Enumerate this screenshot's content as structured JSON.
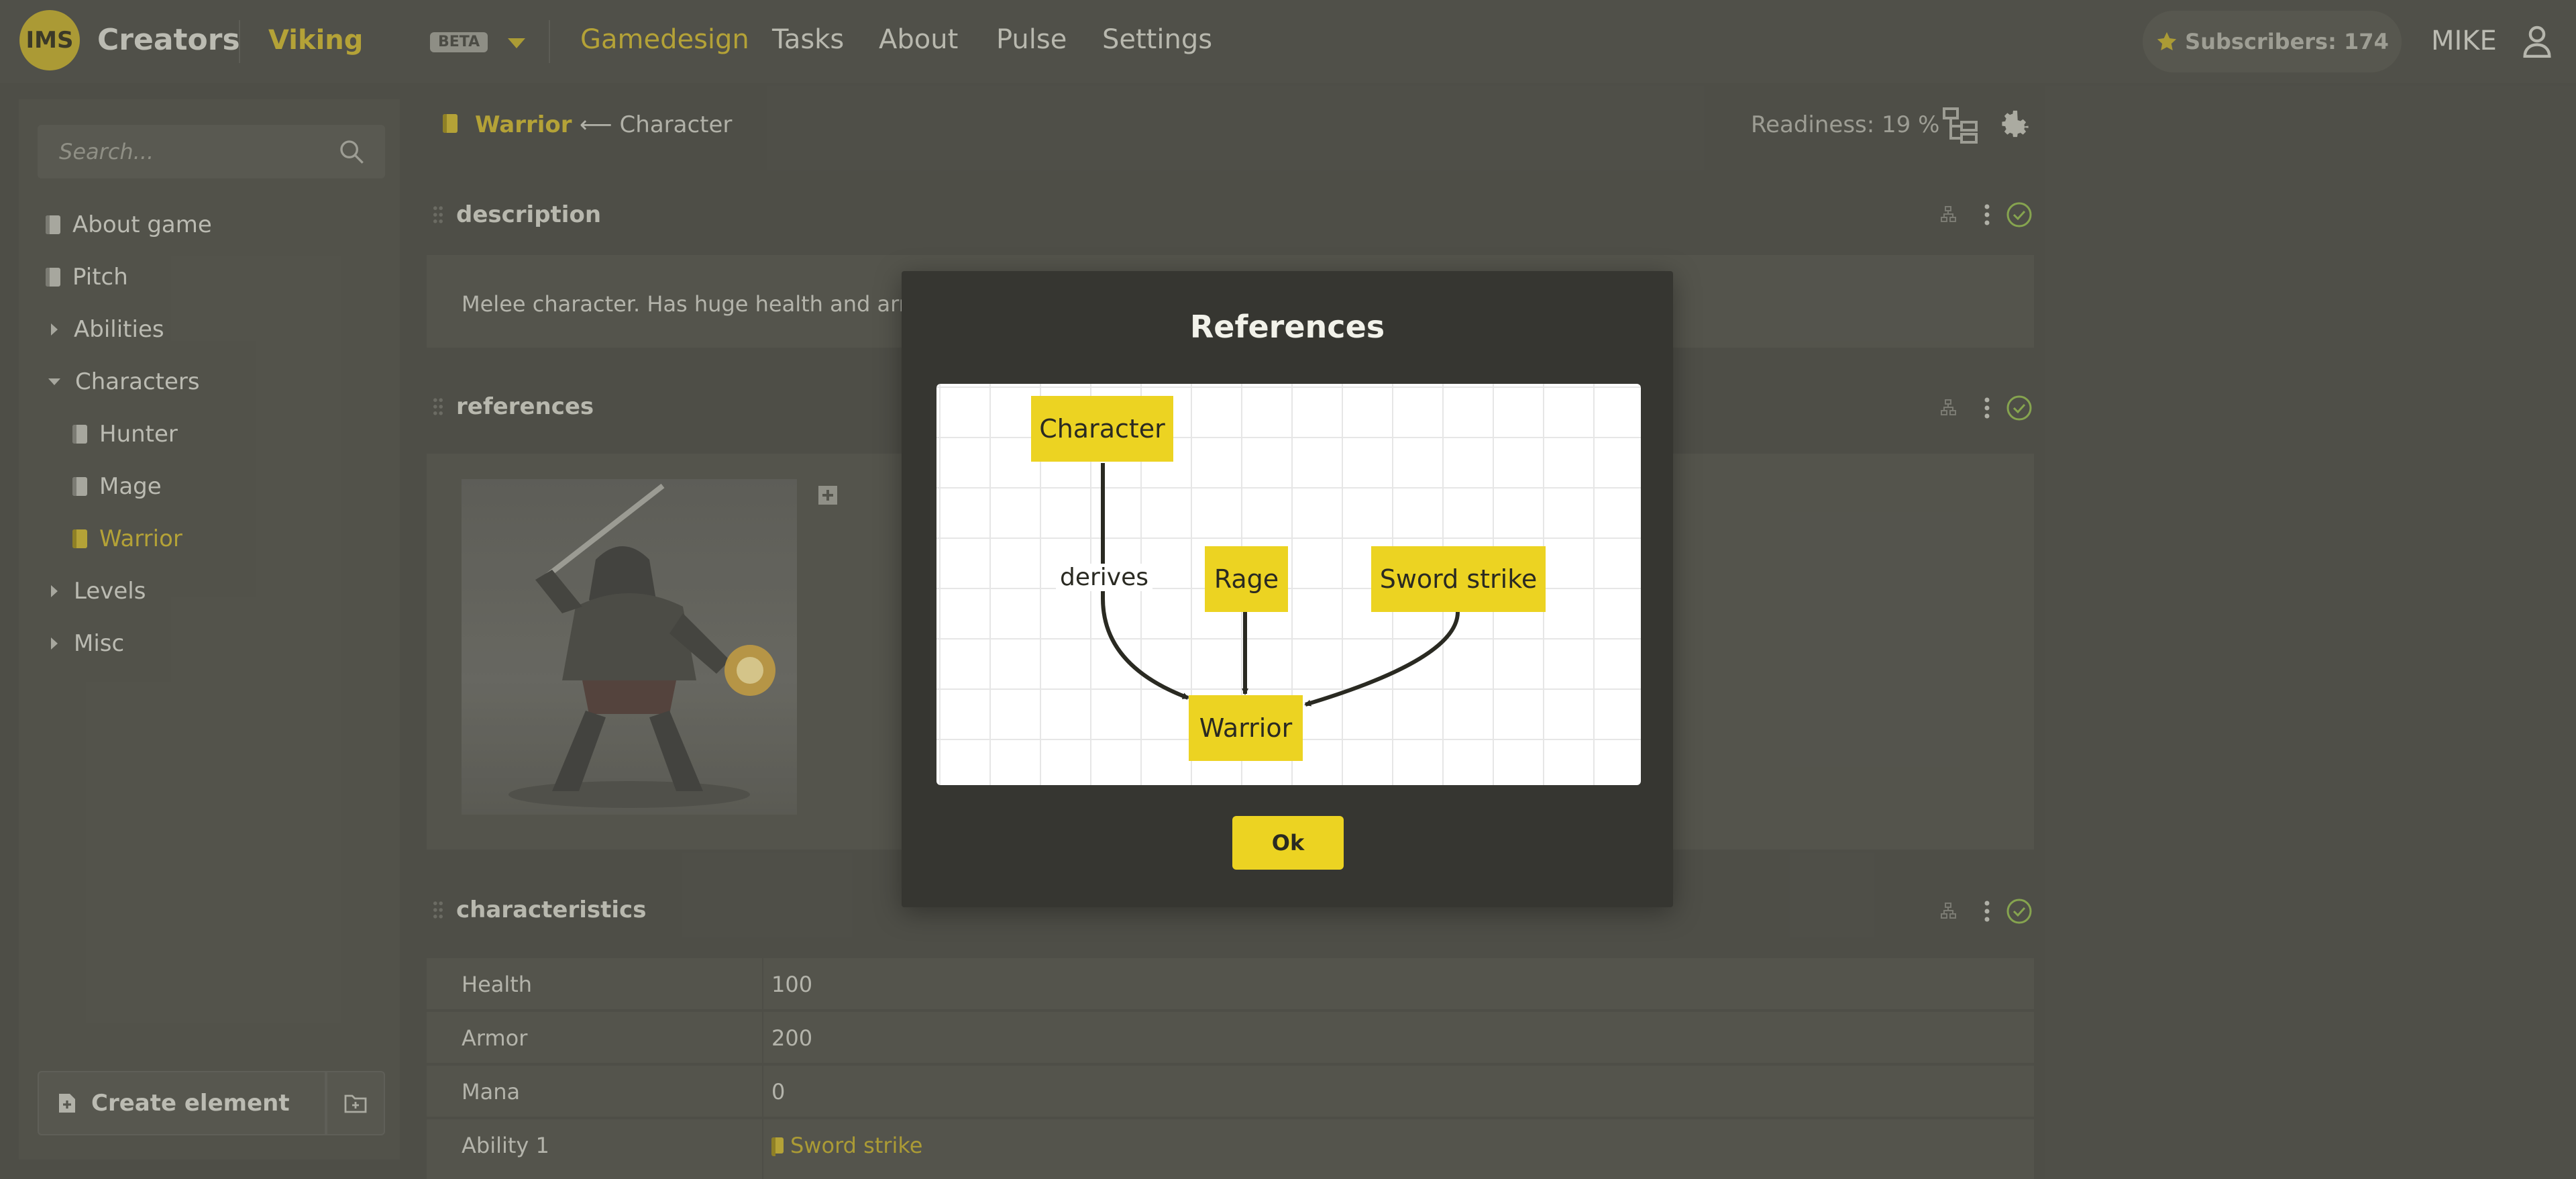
{
  "app": {
    "logo_text": "IMS",
    "brand": "Creators",
    "project": "Viking",
    "beta_badge": "BETA",
    "colors": {
      "accent": "#d4be3c",
      "node": "#ecd322",
      "background": "#575750"
    }
  },
  "nav": {
    "items": [
      {
        "label": "Gamedesign",
        "active": true
      },
      {
        "label": "Tasks",
        "active": false
      },
      {
        "label": "About",
        "active": false
      },
      {
        "label": "Pulse",
        "active": false
      },
      {
        "label": "Settings",
        "active": false
      }
    ]
  },
  "header": {
    "subscribers_label": "Subscribers: 174",
    "user_name": "MIKE"
  },
  "sidebar": {
    "search_placeholder": "Search...",
    "items": [
      {
        "label": "About game",
        "kind": "doc"
      },
      {
        "label": "Pitch",
        "kind": "doc"
      },
      {
        "label": "Abilities",
        "kind": "folder-collapsed"
      },
      {
        "label": "Characters",
        "kind": "folder-expanded"
      },
      {
        "label": "Hunter",
        "kind": "doc",
        "indent": true
      },
      {
        "label": "Mage",
        "kind": "doc",
        "indent": true
      },
      {
        "label": "Warrior",
        "kind": "doc",
        "indent": true,
        "selected": true
      },
      {
        "label": "Levels",
        "kind": "folder-collapsed"
      },
      {
        "label": "Misc",
        "kind": "folder-collapsed"
      }
    ],
    "create_label": "Create element"
  },
  "main": {
    "title": "Warrior",
    "parent_link": "⟵ Character",
    "readiness": "Readiness: 19 %",
    "sections": {
      "description": {
        "title": "description",
        "text": "Melee character. Has huge health and arm"
      },
      "references": {
        "title": "references"
      },
      "characteristics": {
        "title": "characteristics",
        "rows": [
          {
            "key": "Health",
            "value": "100"
          },
          {
            "key": "Armor",
            "value": "200"
          },
          {
            "key": "Mana",
            "value": "0"
          },
          {
            "key": "Ability 1",
            "value": "Sword strike",
            "link": true
          }
        ]
      }
    }
  },
  "modal": {
    "title": "References",
    "ok_label": "Ok",
    "diagram": {
      "nodes": [
        {
          "id": "character",
          "label": "Character"
        },
        {
          "id": "rage",
          "label": "Rage"
        },
        {
          "id": "sword",
          "label": "Sword strike"
        },
        {
          "id": "warrior",
          "label": "Warrior"
        }
      ],
      "edges": [
        {
          "from": "character",
          "to": "warrior",
          "label": "derives"
        },
        {
          "from": "rage",
          "to": "warrior",
          "label": ""
        },
        {
          "from": "sword",
          "to": "warrior",
          "label": ""
        }
      ]
    }
  }
}
